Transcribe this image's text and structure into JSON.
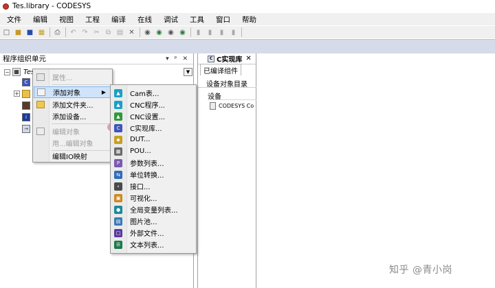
{
  "window": {
    "title": "Tes.library - CODESYS"
  },
  "menubar": [
    "文件",
    "编辑",
    "视图",
    "工程",
    "编译",
    "在线",
    "调试",
    "工具",
    "窗口",
    "帮助"
  ],
  "left_panel": {
    "title": "程序组织单元",
    "controls": [
      "▾",
      "ᵖ",
      "✕"
    ],
    "tree_root_label": "Tes"
  },
  "context_menu": {
    "items": [
      {
        "label": "属性...",
        "disabled": true
      },
      {
        "label": "添加对象",
        "active": true,
        "has_submenu": true
      },
      {
        "label": "添加文件夹..."
      },
      {
        "label": "添加设备..."
      },
      {
        "label": "编辑对象",
        "disabled": true
      },
      {
        "label": "用...编辑对象",
        "disabled": true
      },
      {
        "label": "编辑IO映射"
      }
    ]
  },
  "submenu": {
    "items": [
      {
        "label": "Cam表...",
        "icon": "cam-table-icon",
        "color": "#1aa0c8"
      },
      {
        "label": "CNC程序...",
        "icon": "cnc-program-icon",
        "color": "#1aa0c8"
      },
      {
        "label": "CNC设置...",
        "icon": "cnc-settings-icon",
        "color": "#2e9a3a"
      },
      {
        "label": "C实现库...",
        "icon": "c-implementation-library-icon",
        "color": "#3f55b8"
      },
      {
        "label": "DUT...",
        "icon": "dut-icon",
        "color": "#c8a020"
      },
      {
        "label": "POU...",
        "icon": "pou-icon",
        "color": "#6a6a6a"
      },
      {
        "label": "参数列表...",
        "icon": "parameter-list-icon",
        "color": "#7a5ab0"
      },
      {
        "label": "单位转换...",
        "icon": "unit-conversion-icon",
        "color": "#2f6db8"
      },
      {
        "label": "接口...",
        "icon": "interface-icon",
        "color": "#4a4a4a"
      },
      {
        "label": "可视化...",
        "icon": "visualization-icon",
        "color": "#d08a1a"
      },
      {
        "label": "全局变量列表...",
        "icon": "global-variable-list-icon",
        "color": "#1a8a9a"
      },
      {
        "label": "图片池...",
        "icon": "image-pool-icon",
        "color": "#3a7ab8"
      },
      {
        "label": "外部文件...",
        "icon": "external-file-icon",
        "color": "#5a3aa0"
      },
      {
        "label": "文本列表...",
        "icon": "text-list-icon",
        "color": "#1a7a4a"
      }
    ]
  },
  "right_panel": {
    "tab_title": "C实现库",
    "close": "✕",
    "subtab": "已编译组件",
    "section": "设备对象目录",
    "header": "设备",
    "row": "CODESYS Co"
  },
  "watermark": "知乎 @青小岗"
}
